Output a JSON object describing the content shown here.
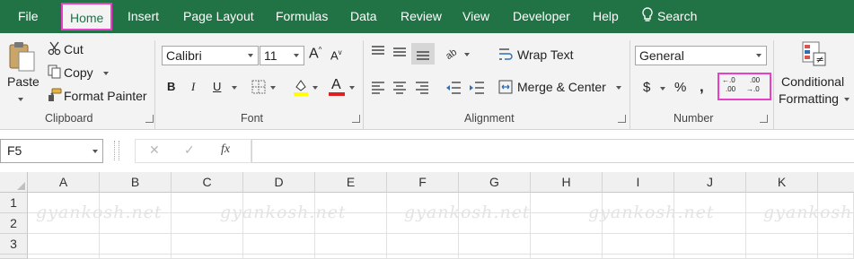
{
  "tabs": [
    "File",
    "Home",
    "Insert",
    "Page Layout",
    "Formulas",
    "Data",
    "Review",
    "View",
    "Developer",
    "Help"
  ],
  "search": {
    "label": "Search"
  },
  "clipboard": {
    "paste": "Paste",
    "cut": "Cut",
    "copy": "Copy",
    "format_painter": "Format Painter",
    "group": "Clipboard"
  },
  "font": {
    "name": "Calibri",
    "size": "11",
    "group": "Font",
    "bold": "B",
    "italic": "I",
    "underline": "U",
    "grow": "A",
    "shrink": "A",
    "font_color_letter": "A"
  },
  "alignment": {
    "wrap_text": "Wrap Text",
    "merge_center": "Merge & Center",
    "group": "Alignment"
  },
  "number": {
    "format": "General",
    "currency": "$",
    "percent": "%",
    "comma": ",",
    "group": "Number",
    "increase_decimal_top": "←.0",
    "increase_decimal_bottom": ".00",
    "decrease_decimal_top": ".00",
    "decrease_decimal_bottom": "→.0"
  },
  "styles": {
    "conditional_line1": "Conditional",
    "conditional_line2": "Formatting"
  },
  "formula_bar": {
    "name_box": "F5",
    "cancel": "✕",
    "enter": "✓",
    "fx": "fx"
  },
  "columns": [
    "A",
    "B",
    "C",
    "D",
    "E",
    "F",
    "G",
    "H",
    "I",
    "J",
    "K"
  ],
  "rows": [
    "1",
    "2",
    "3"
  ],
  "watermark": "gyankosh.net",
  "colors": {
    "tab_bar": "#217346",
    "highlight": "#e83ec8",
    "font_color": "#e02020",
    "fill_color": "#ffff00"
  }
}
